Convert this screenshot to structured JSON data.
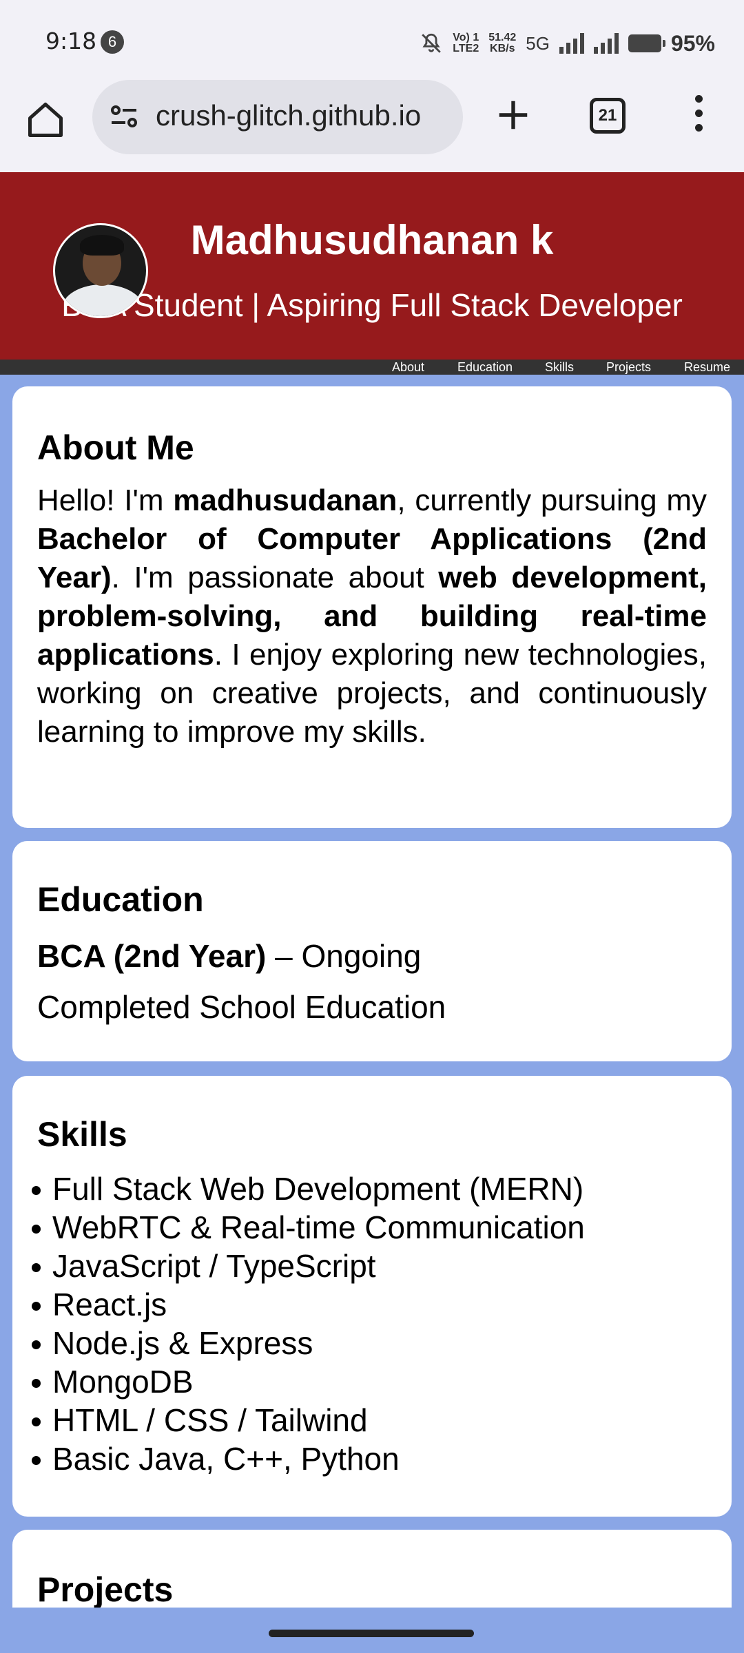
{
  "status_bar": {
    "time": "9:18",
    "notification_count": "6",
    "network_label_top": "Vo) 1",
    "network_label_bottom": "LTE2",
    "speed_value": "51.42",
    "speed_unit": "KB/s",
    "network_type": "5G",
    "battery": "95%"
  },
  "browser": {
    "url": "crush-glitch.github.io",
    "tab_count": "21"
  },
  "header": {
    "name": "Madhusudhanan k",
    "tagline": "BCA Student | Aspiring Full Stack Developer",
    "colors": {
      "header_bg": "#961a1c",
      "page_bg": "#8aa6e6"
    }
  },
  "nav": {
    "items": [
      "About",
      "Education",
      "Skills",
      "Projects",
      "Resume"
    ]
  },
  "about": {
    "title": "About Me",
    "p1": "Hello! I'm ",
    "name_bold": "madhusudanan",
    "p2": ", currently pursuing my ",
    "degree_bold": "Bachelor of Computer Applications (2nd Year)",
    "p3": ". I'm passionate about ",
    "interests_bold": "web development, problem-solving, and building real-time applications",
    "p4": ". I enjoy exploring new technologies, working on creative projects, and continuously learning to improve my skills."
  },
  "education": {
    "title": "Education",
    "degree": "BCA (2nd Year)",
    "degree_status": " – Ongoing",
    "school": "Completed School Education"
  },
  "skills": {
    "title": "Skills",
    "items": [
      "Full Stack Web Development (MERN)",
      "WebRTC & Real-time Communication",
      "JavaScript / TypeScript",
      "React.js",
      "Node.js & Express",
      "MongoDB",
      "HTML / CSS / Tailwind",
      "Basic Java, C++, Python"
    ]
  },
  "projects": {
    "title": "Projects"
  }
}
